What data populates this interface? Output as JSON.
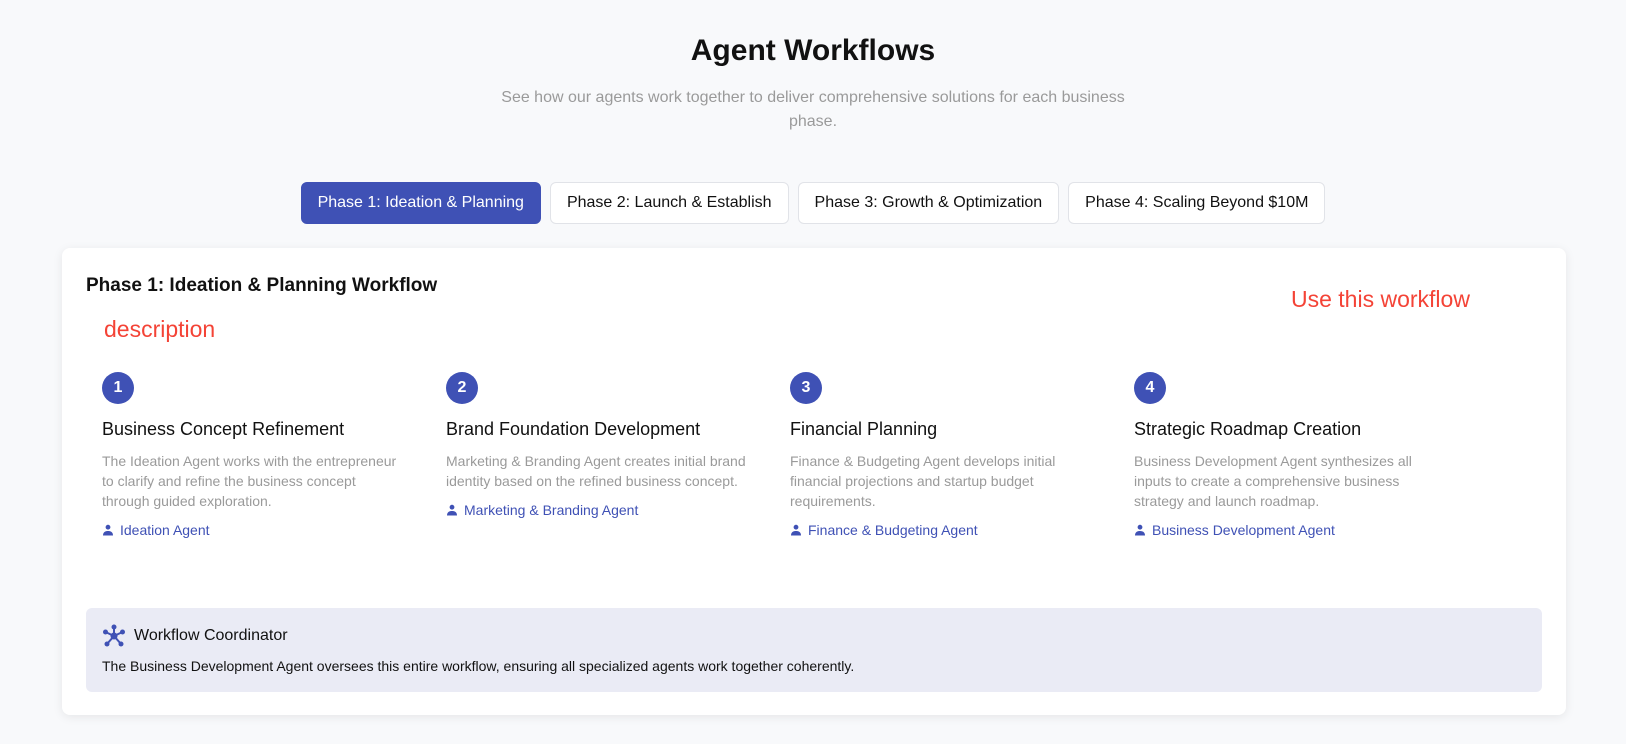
{
  "header": {
    "title": "Agent Workflows",
    "subtitle": "See how our agents work together to deliver comprehensive solutions for each business phase."
  },
  "tabs": [
    {
      "label": "Phase 1: Ideation & Planning",
      "active": true
    },
    {
      "label": "Phase 2: Launch & Establish",
      "active": false
    },
    {
      "label": "Phase 3: Growth & Optimization",
      "active": false
    },
    {
      "label": "Phase 4: Scaling Beyond $10M",
      "active": false
    }
  ],
  "workflow": {
    "title": "Phase 1: Ideation & Planning Workflow",
    "use_label": "Use this workflow",
    "description": "description",
    "steps": [
      {
        "number": "1",
        "title": "Business Concept Refinement",
        "description": "The Ideation Agent works with the entrepreneur to clarify and refine the business concept through guided exploration.",
        "agent": "Ideation Agent"
      },
      {
        "number": "2",
        "title": "Brand Foundation Development",
        "description": "Marketing & Branding Agent creates initial brand identity based on the refined business concept.",
        "agent": "Marketing & Branding Agent"
      },
      {
        "number": "3",
        "title": "Financial Planning",
        "description": "Finance & Budgeting Agent develops initial financial projections and startup budget requirements.",
        "agent": "Finance & Budgeting Agent"
      },
      {
        "number": "4",
        "title": "Strategic Roadmap Creation",
        "description": "Business Development Agent synthesizes all inputs to create a comprehensive business strategy and launch roadmap.",
        "agent": "Business Development Agent"
      }
    ],
    "coordinator": {
      "icon": "hub-icon",
      "title": "Workflow Coordinator",
      "text": "The Business Development Agent oversees this entire workflow, ensuring all specialized agents work together coherently."
    }
  },
  "colors": {
    "accent": "#3f51b5",
    "annotation_red": "#f44336",
    "muted_text": "#9a9a9a",
    "coordinator_bg": "#eaebf5"
  }
}
